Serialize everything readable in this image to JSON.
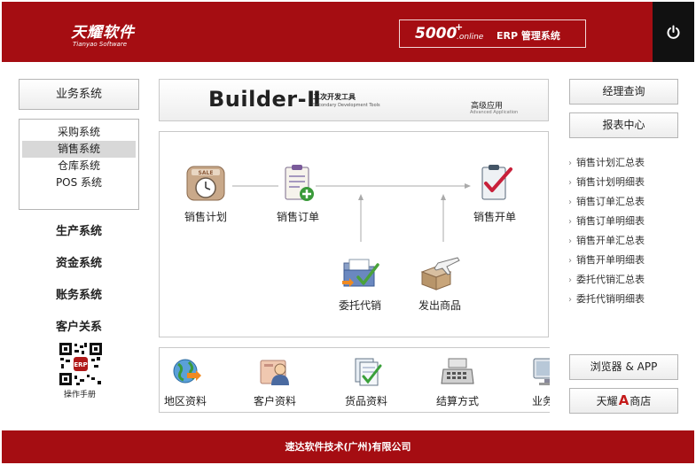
{
  "header": {
    "logo_main": "天耀软件",
    "logo_sub": "Tianyao Software",
    "version_number": "5000",
    "version_plus": "+",
    "version_online": ".online",
    "erp_label": "ERP 管理系统",
    "power_icon": "power-icon"
  },
  "left": {
    "top_button": "业务系统",
    "submenu": [
      {
        "label": "采购系统",
        "active": false
      },
      {
        "label": "销售系统",
        "active": true
      },
      {
        "label": "仓库系统",
        "active": false
      },
      {
        "label": "POS 系统",
        "active": false
      }
    ],
    "links": [
      "生产系统",
      "资金系统",
      "账务系统",
      "客户关系"
    ],
    "qr_badge": "ERP",
    "qr_label": "操作手册"
  },
  "builder": {
    "title": "Builder-Ⅱ",
    "cn": "二次开发工具",
    "en": "Secondary Development Tools",
    "advanced": "高级应用",
    "advanced_en": "Advanced Application"
  },
  "flow": {
    "nodes": [
      {
        "label": "销售计划",
        "icon": "sale-clock-icon"
      },
      {
        "label": "销售订单",
        "icon": "clipboard-add-icon"
      },
      {
        "label": "销售开单",
        "icon": "clipboard-check-icon"
      },
      {
        "label": "委托代销",
        "icon": "folder-check-icon"
      },
      {
        "label": "发出商品",
        "icon": "box-plane-icon"
      }
    ]
  },
  "bottom": {
    "items": [
      {
        "label": "地区资料",
        "icon": "globe-icon"
      },
      {
        "label": "客户资料",
        "icon": "customer-card-icon"
      },
      {
        "label": "货品资料",
        "icon": "goods-docs-icon"
      },
      {
        "label": "结算方式",
        "icon": "cash-register-icon"
      },
      {
        "label": "业务员",
        "icon": "monitor-icon"
      }
    ]
  },
  "right": {
    "top_buttons": [
      "经理查询",
      "报表中心"
    ],
    "links": [
      "销售计划汇总表",
      "销售计划明细表",
      "销售订单汇总表",
      "销售订单明细表",
      "销售开单汇总表",
      "销售开单明细表",
      "委托代销汇总表",
      "委托代销明细表"
    ],
    "browser_label": "浏览器 & APP",
    "shop_prefix": "天耀",
    "shop_letter": "A",
    "shop_suffix": "商店"
  },
  "footer": {
    "company": "速达软件技术(广州)有限公司"
  },
  "colors": {
    "brand_red": "#a50d12",
    "power_bg": "#111111",
    "shop_red": "#c41a1a"
  }
}
